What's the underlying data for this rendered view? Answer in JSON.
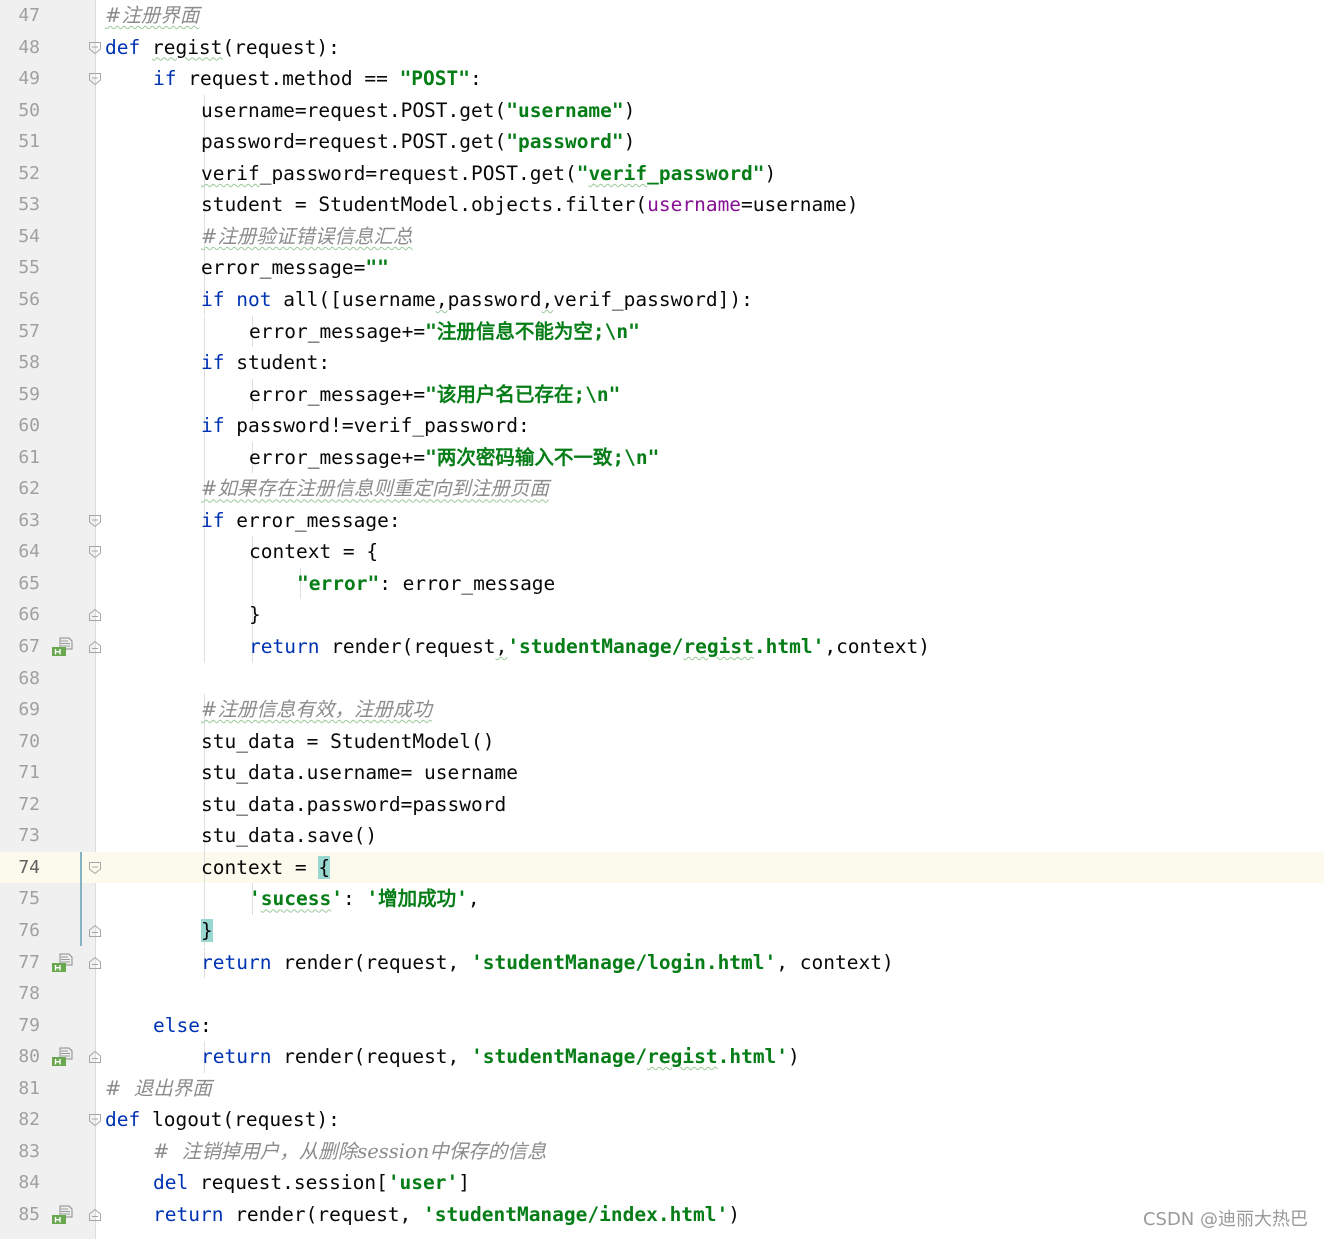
{
  "watermark": "CSDN @迪丽大热巴",
  "current_line": 74,
  "colors": {
    "keyword": "#0033b3",
    "string": "#067d17",
    "comment": "#8c8c8c",
    "param": "#871094",
    "brace_match": "#99d8d0",
    "current_line_bg": "#fcfaed"
  },
  "lines": [
    {
      "num": "47",
      "indent": 0,
      "tokens": [
        {
          "t": "com",
          "v": "#注册界面",
          "sq": true
        }
      ]
    },
    {
      "num": "48",
      "indent": 0,
      "fold": "open",
      "tokens": [
        {
          "t": "kw",
          "v": "def "
        },
        {
          "t": "txt",
          "v": "regist",
          "sq": true
        },
        {
          "t": "txt",
          "v": "(request):"
        }
      ]
    },
    {
      "num": "49",
      "indent": 1,
      "fold": "open",
      "tokens": [
        {
          "t": "kw",
          "v": "if "
        },
        {
          "t": "txt",
          "v": "request.method == "
        },
        {
          "t": "str",
          "v": "\"POST\""
        },
        {
          "t": "txt",
          "v": ":"
        }
      ]
    },
    {
      "num": "50",
      "indent": 2,
      "tokens": [
        {
          "t": "txt",
          "v": "username=request.POST.get("
        },
        {
          "t": "str",
          "v": "\"username\""
        },
        {
          "t": "txt",
          "v": ")"
        }
      ]
    },
    {
      "num": "51",
      "indent": 2,
      "tokens": [
        {
          "t": "txt",
          "v": "password=request.POST.get("
        },
        {
          "t": "str",
          "v": "\"password\""
        },
        {
          "t": "txt",
          "v": ")"
        }
      ]
    },
    {
      "num": "52",
      "indent": 2,
      "tokens": [
        {
          "t": "txt",
          "v": "verif",
          "sq": true
        },
        {
          "t": "txt",
          "v": "_password=request.POST.get("
        },
        {
          "t": "str",
          "v": "\""
        },
        {
          "t": "str",
          "v": "verif",
          "sq": true
        },
        {
          "t": "str",
          "v": "_password\""
        },
        {
          "t": "txt",
          "v": ")"
        }
      ]
    },
    {
      "num": "53",
      "indent": 2,
      "tokens": [
        {
          "t": "txt",
          "v": "student = StudentModel.objects.filter("
        },
        {
          "t": "param",
          "v": "username"
        },
        {
          "t": "txt",
          "v": "=username)"
        }
      ]
    },
    {
      "num": "54",
      "indent": 2,
      "tokens": [
        {
          "t": "com",
          "v": "#注册验证错误信息汇总",
          "sq": true
        }
      ]
    },
    {
      "num": "55",
      "indent": 2,
      "tokens": [
        {
          "t": "txt",
          "v": "error_message="
        },
        {
          "t": "str",
          "v": "\"\""
        }
      ]
    },
    {
      "num": "56",
      "indent": 2,
      "tokens": [
        {
          "t": "kw",
          "v": "if not "
        },
        {
          "t": "txt",
          "v": "all([username"
        },
        {
          "t": "txt",
          "v": ",",
          "sq": true
        },
        {
          "t": "txt",
          "v": "password"
        },
        {
          "t": "txt",
          "v": ",",
          "sq": true
        },
        {
          "t": "txt",
          "v": "verif_password]):"
        }
      ]
    },
    {
      "num": "57",
      "indent": 3,
      "tokens": [
        {
          "t": "txt",
          "v": "error_message+="
        },
        {
          "t": "str",
          "v": "\"注册信息不能为空;\\n\""
        }
      ]
    },
    {
      "num": "58",
      "indent": 2,
      "tokens": [
        {
          "t": "kw",
          "v": "if "
        },
        {
          "t": "txt",
          "v": "student:"
        }
      ]
    },
    {
      "num": "59",
      "indent": 3,
      "tokens": [
        {
          "t": "txt",
          "v": "error_message+="
        },
        {
          "t": "str",
          "v": "\"该用户名已存在;\\n\""
        }
      ]
    },
    {
      "num": "60",
      "indent": 2,
      "tokens": [
        {
          "t": "kw",
          "v": "if "
        },
        {
          "t": "txt",
          "v": "password!=verif_password:"
        }
      ]
    },
    {
      "num": "61",
      "indent": 3,
      "tokens": [
        {
          "t": "txt",
          "v": "error_message+="
        },
        {
          "t": "str",
          "v": "\"两次密码输入不一致;\\n\""
        }
      ]
    },
    {
      "num": "62",
      "indent": 2,
      "tokens": [
        {
          "t": "com",
          "v": "#如果存在注册信息则重定向到注册页面",
          "sq": true
        }
      ]
    },
    {
      "num": "63",
      "indent": 2,
      "fold": "open",
      "tokens": [
        {
          "t": "kw",
          "v": "if "
        },
        {
          "t": "txt",
          "v": "error_message:"
        }
      ]
    },
    {
      "num": "64",
      "indent": 3,
      "fold": "open",
      "tokens": [
        {
          "t": "txt",
          "v": "context = {"
        }
      ]
    },
    {
      "num": "65",
      "indent": 4,
      "tokens": [
        {
          "t": "str",
          "v": "\"error\""
        },
        {
          "t": "txt",
          "v": ": error_message"
        }
      ]
    },
    {
      "num": "66",
      "indent": 3,
      "fold": "close",
      "tokens": [
        {
          "t": "txt",
          "v": "}"
        }
      ]
    },
    {
      "num": "67",
      "indent": 3,
      "fold": "close",
      "mark": true,
      "tokens": [
        {
          "t": "kw",
          "v": "return "
        },
        {
          "t": "txt",
          "v": "render(request"
        },
        {
          "t": "txt",
          "v": ",",
          "sq": true
        },
        {
          "t": "str",
          "v": "'studentManage/"
        },
        {
          "t": "str",
          "v": "regist",
          "sq": true
        },
        {
          "t": "str",
          "v": ".html'"
        },
        {
          "t": "txt",
          "v": ",context)"
        }
      ]
    },
    {
      "num": "68",
      "indent": 0,
      "tokens": []
    },
    {
      "num": "69",
      "indent": 2,
      "tokens": [
        {
          "t": "com",
          "v": "#注册信息有效，注册成功",
          "sq": true
        }
      ]
    },
    {
      "num": "70",
      "indent": 2,
      "tokens": [
        {
          "t": "txt",
          "v": "stu_data = StudentModel()"
        }
      ]
    },
    {
      "num": "71",
      "indent": 2,
      "tokens": [
        {
          "t": "txt",
          "v": "stu_data.username= username"
        }
      ]
    },
    {
      "num": "72",
      "indent": 2,
      "tokens": [
        {
          "t": "txt",
          "v": "stu_data.password=password"
        }
      ]
    },
    {
      "num": "73",
      "indent": 2,
      "tokens": [
        {
          "t": "txt",
          "v": "stu_data.save()"
        }
      ]
    },
    {
      "num": "74",
      "indent": 2,
      "fold": "open",
      "tokens": [
        {
          "t": "txt",
          "v": "context = "
        },
        {
          "t": "brace",
          "v": "{"
        }
      ]
    },
    {
      "num": "75",
      "indent": 3,
      "tokens": [
        {
          "t": "str",
          "v": "'"
        },
        {
          "t": "str",
          "v": "sucess",
          "sq": true
        },
        {
          "t": "str",
          "v": "'"
        },
        {
          "t": "txt",
          "v": ": "
        },
        {
          "t": "str",
          "v": "'增加成功'"
        },
        {
          "t": "txt",
          "v": ","
        }
      ]
    },
    {
      "num": "76",
      "indent": 2,
      "fold": "close",
      "tokens": [
        {
          "t": "brace",
          "v": "}"
        }
      ]
    },
    {
      "num": "77",
      "indent": 2,
      "fold": "close",
      "mark": true,
      "tokens": [
        {
          "t": "kw",
          "v": "return "
        },
        {
          "t": "txt",
          "v": "render(request, "
        },
        {
          "t": "str",
          "v": "'studentManage/login.html'"
        },
        {
          "t": "txt",
          "v": ", context)"
        }
      ]
    },
    {
      "num": "78",
      "indent": 0,
      "tokens": []
    },
    {
      "num": "79",
      "indent": 1,
      "tokens": [
        {
          "t": "kw",
          "v": "else"
        },
        {
          "t": "txt",
          "v": ":"
        }
      ]
    },
    {
      "num": "80",
      "indent": 2,
      "fold": "close",
      "mark": true,
      "tokens": [
        {
          "t": "kw",
          "v": "return "
        },
        {
          "t": "txt",
          "v": "render(request, "
        },
        {
          "t": "str",
          "v": "'studentManage/"
        },
        {
          "t": "str",
          "v": "regist",
          "sq": true
        },
        {
          "t": "str",
          "v": ".html'"
        },
        {
          "t": "txt",
          "v": ")"
        }
      ]
    },
    {
      "num": "81",
      "indent": 0,
      "tokens": [
        {
          "t": "com",
          "v": "#  退出界面"
        }
      ]
    },
    {
      "num": "82",
      "indent": 0,
      "fold": "open",
      "tokens": [
        {
          "t": "kw",
          "v": "def "
        },
        {
          "t": "txt",
          "v": "logout(request):"
        }
      ]
    },
    {
      "num": "83",
      "indent": 1,
      "tokens": [
        {
          "t": "com",
          "v": "#  注销掉用户，从删除session中保存的信息"
        }
      ]
    },
    {
      "num": "84",
      "indent": 1,
      "tokens": [
        {
          "t": "kw",
          "v": "del "
        },
        {
          "t": "txt",
          "v": "request.session["
        },
        {
          "t": "str",
          "v": "'user'"
        },
        {
          "t": "txt",
          "v": "]"
        }
      ]
    },
    {
      "num": "85",
      "indent": 1,
      "fold": "close",
      "mark": true,
      "tokens": [
        {
          "t": "kw",
          "v": "return "
        },
        {
          "t": "txt",
          "v": "render(request, "
        },
        {
          "t": "str",
          "v": "'studentManage/index.html'"
        },
        {
          "t": "txt",
          "v": ")"
        }
      ]
    }
  ]
}
